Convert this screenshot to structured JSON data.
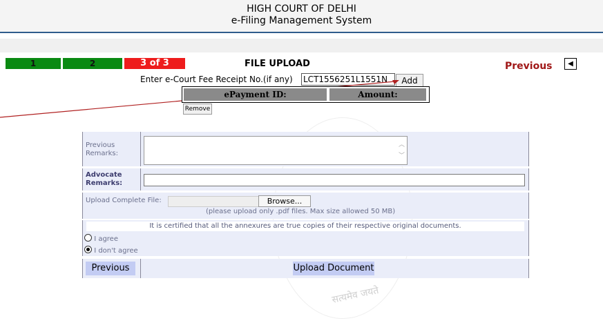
{
  "header": {
    "line1": "HIGH COURT OF DELHI",
    "line2": "e-Filing Management System"
  },
  "steps": [
    {
      "label": "1",
      "color": "#0a8a12"
    },
    {
      "label": "2",
      "color": "#0a8a12"
    },
    {
      "label": "3 of 3",
      "color": "#ee1c1c"
    }
  ],
  "page_title": "FILE UPLOAD",
  "nav": {
    "previous_label": "Previous",
    "previous_icon": "left-triangle-icon"
  },
  "court_fee": {
    "label": "Enter e-Court Fee Receipt No.(if any)",
    "value": "LCT1556251L1551N",
    "add_label": "Add"
  },
  "payment_table": {
    "headers": [
      "ePayment ID:",
      "Amount:"
    ]
  },
  "remove_label": "Remove",
  "form": {
    "previous_remarks_label": "Previous Remarks:",
    "advocate_remarks_label": "Advocate Remarks:",
    "upload_label": "Upload Complete File:",
    "browse_label": "Browse...",
    "upload_note": "(please upload only .pdf files. Max size allowed 50 MB)",
    "certification": "It is certified that all the annexures are true copies of their respective original documents.",
    "agree_label": "I agree",
    "disagree_label": "I don't agree",
    "selected": "I don't agree",
    "previous_button": "Previous",
    "upload_button": "Upload Document"
  },
  "watermark": {
    "text": "सत्यमेव जयते"
  },
  "colors": {
    "header_rule": "#2f5d8c",
    "previous_link": "#a01818",
    "form_bg": "#eaedf9",
    "button_bg": "#c3ccf3"
  }
}
